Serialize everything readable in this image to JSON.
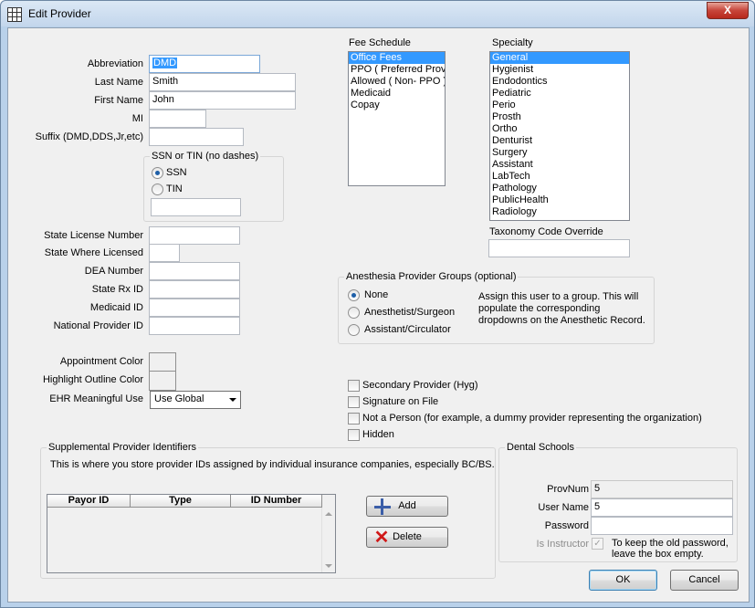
{
  "window": {
    "title": "Edit Provider",
    "close_label": "X"
  },
  "fields": {
    "abbreviation": {
      "label": "Abbreviation",
      "value": "DMD"
    },
    "last_name": {
      "label": "Last Name",
      "value": "Smith"
    },
    "first_name": {
      "label": "First Name",
      "value": "John"
    },
    "mi": {
      "label": "MI",
      "value": ""
    },
    "suffix": {
      "label": "Suffix (DMD,DDS,Jr,etc)",
      "value": ""
    },
    "state_license": {
      "label": "State License Number",
      "value": ""
    },
    "state_where_licensed": {
      "label": "State Where Licensed",
      "value": ""
    },
    "dea": {
      "label": "DEA Number",
      "value": ""
    },
    "state_rx": {
      "label": "State Rx ID",
      "value": ""
    },
    "medicaid": {
      "label": "Medicaid ID",
      "value": ""
    },
    "npi": {
      "label": "National Provider ID",
      "value": ""
    }
  },
  "ssn_group": {
    "title": "SSN or TIN (no dashes)",
    "options": [
      "SSN",
      "TIN"
    ],
    "selected": "SSN",
    "value": ""
  },
  "fee_schedule": {
    "label": "Fee Schedule",
    "items": [
      "Office Fees",
      "PPO ( Preferred Provider )",
      "Allowed ( Non- PPO )",
      "Medicaid",
      "Copay"
    ],
    "selected_index": 0
  },
  "specialty": {
    "label": "Specialty",
    "items": [
      "General",
      "Hygienist",
      "Endodontics",
      "Pediatric",
      "Perio",
      "Prosth",
      "Ortho",
      "Denturist",
      "Surgery",
      "Assistant",
      "LabTech",
      "Pathology",
      "PublicHealth",
      "Radiology"
    ],
    "selected_index": 0
  },
  "taxonomy": {
    "label": "Taxonomy Code Override",
    "value": ""
  },
  "anesthesia": {
    "title": "Anesthesia Provider Groups (optional)",
    "options": [
      "None",
      "Anesthetist/Surgeon",
      "Assistant/Circulator"
    ],
    "selected": "None",
    "note": "Assign this user to a group. This will populate the corresponding dropdowns on the Anesthetic Record."
  },
  "colors": {
    "appointment_label": "Appointment Color",
    "highlight_label": "Highlight Outline Color"
  },
  "ehr": {
    "label": "EHR Meaningful Use",
    "value": "Use Global"
  },
  "checkboxes": {
    "secondary": "Secondary Provider (Hyg)",
    "signature": "Signature on File",
    "not_person": "Not a Person (for example, a dummy provider representing the organization)",
    "hidden": "Hidden"
  },
  "supplemental": {
    "title": "Supplemental Provider Identifiers",
    "description": "This is where you store provider IDs assigned by individual insurance companies, especially BC/BS.",
    "columns": [
      "Payor ID",
      "Type",
      "ID Number"
    ],
    "add_label": "Add",
    "delete_label": "Delete"
  },
  "dental_schools": {
    "title": "Dental Schools",
    "provnum_label": "ProvNum",
    "provnum_value": "5",
    "username_label": "User Name",
    "username_value": "5",
    "password_label": "Password",
    "password_value": "",
    "instructor_label": "Is Instructor",
    "password_note": "To keep the old password, leave the box empty."
  },
  "buttons": {
    "ok": "OK",
    "cancel": "Cancel"
  }
}
